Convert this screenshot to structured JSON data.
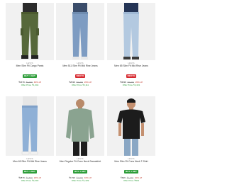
{
  "products": [
    {
      "brand": "LEVIS",
      "name": "Men Slim Fit Cargo Pants",
      "badge": "BUY 1 GET",
      "badge_color": "green",
      "price": "₹1679",
      "mrp": "₹2,799",
      "discount": "40% off",
      "offer": "Offer Price ₹1,344"
    },
    {
      "brand": "LEVIS",
      "name": "Men 511 Slim Fit Mid Rise Jeans",
      "badge": "NEW IN",
      "badge_color": "red",
      "price": "₹2639",
      "mrp": "₹3,299",
      "discount": "20% off",
      "offer": "Offer Price ₹2,111"
    },
    {
      "brand": "LEVIS",
      "name": "Men 65 Slim Fit Mid Rise Jeans",
      "badge": "NEW IN",
      "badge_color": "red",
      "price": "₹3039",
      "mrp": "₹3,799",
      "discount": "20% off",
      "offer": "Offer Price ₹2,431"
    },
    {
      "brand": "LEVIS",
      "name": "Men 65 Slim Fit Mid Rise Jeans",
      "badge": "BUY 1 GET",
      "badge_color": "green",
      "price": "₹2879",
      "mrp": "₹3,599",
      "discount": "20% off",
      "offer": "Offer Price ₹2,303"
    },
    {
      "brand": "LEVIS",
      "name": "Men Regular Fit Crew Neck Sweatshirt",
      "badge": "BUY 1 GET",
      "badge_color": "green",
      "price": "₹1799",
      "mrp": "₹2,999",
      "discount": "40% off",
      "offer": "Offer Price ₹1,439"
    },
    {
      "brand": "LEVIS",
      "name": "Men Slim Fit Crew Neck T-Shirt",
      "badge": "BUY 1 GET",
      "badge_color": "green",
      "price": "₹629",
      "mrp": "₹1,049",
      "discount": "40% off",
      "offer": "Offer Price ₹503"
    }
  ]
}
